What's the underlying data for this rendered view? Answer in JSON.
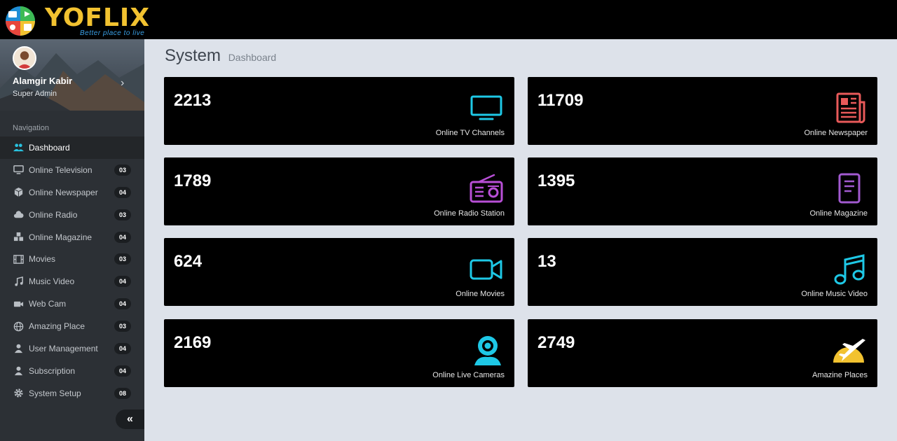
{
  "brand": {
    "name": "YOFLIX",
    "tagline": "Better place to live"
  },
  "user": {
    "name": "Alamgir Kabir",
    "role": "Super Admin"
  },
  "navigation": {
    "heading": "Navigation",
    "items": [
      {
        "label": "Dashboard",
        "icon": "users-icon",
        "badge": ""
      },
      {
        "label": "Online Television",
        "icon": "monitor-icon",
        "badge": "03"
      },
      {
        "label": "Online Newspaper",
        "icon": "cube-icon",
        "badge": "04"
      },
      {
        "label": "Online Radio",
        "icon": "cloud-icon",
        "badge": "03"
      },
      {
        "label": "Online Magazine",
        "icon": "cubes-icon",
        "badge": "04"
      },
      {
        "label": "Movies",
        "icon": "film-icon",
        "badge": "03"
      },
      {
        "label": "Music Video",
        "icon": "music-icon",
        "badge": "04"
      },
      {
        "label": "Web Cam",
        "icon": "video-icon",
        "badge": "04"
      },
      {
        "label": "Amazing Place",
        "icon": "globe-icon",
        "badge": "03"
      },
      {
        "label": "User Management",
        "icon": "user-icon",
        "badge": "04"
      },
      {
        "label": "Subscription",
        "icon": "user-icon",
        "badge": "04"
      },
      {
        "label": "System Setup",
        "icon": "gear-icon",
        "badge": "08"
      }
    ],
    "collapse_label": "«"
  },
  "page": {
    "title": "System",
    "subtitle": "Dashboard"
  },
  "cards": [
    {
      "value": "2213",
      "label": "Online TV Channels",
      "icon": "tv-icon",
      "color": "#1ec8e6"
    },
    {
      "value": "11709",
      "label": "Online Newspaper",
      "icon": "newspaper-icon",
      "color": "#e85a5a"
    },
    {
      "value": "1789",
      "label": "Online Radio Station",
      "icon": "radio-icon",
      "color": "#b84fd6"
    },
    {
      "value": "1395",
      "label": "Online Magazine",
      "icon": "document-icon",
      "color": "#a25ad0"
    },
    {
      "value": "624",
      "label": "Online Movies",
      "icon": "video-camera-icon",
      "color": "#1ec8e6"
    },
    {
      "value": "13",
      "label": "Online Music Video",
      "icon": "music-note-icon",
      "color": "#1ec8e6"
    },
    {
      "value": "2169",
      "label": "Online Live Cameras",
      "icon": "webcam-icon",
      "color": "#1ec8e6"
    },
    {
      "value": "2749",
      "label": "Amazine Places",
      "icon": "airplane-sun-icon",
      "color": "#f2c230"
    }
  ]
}
